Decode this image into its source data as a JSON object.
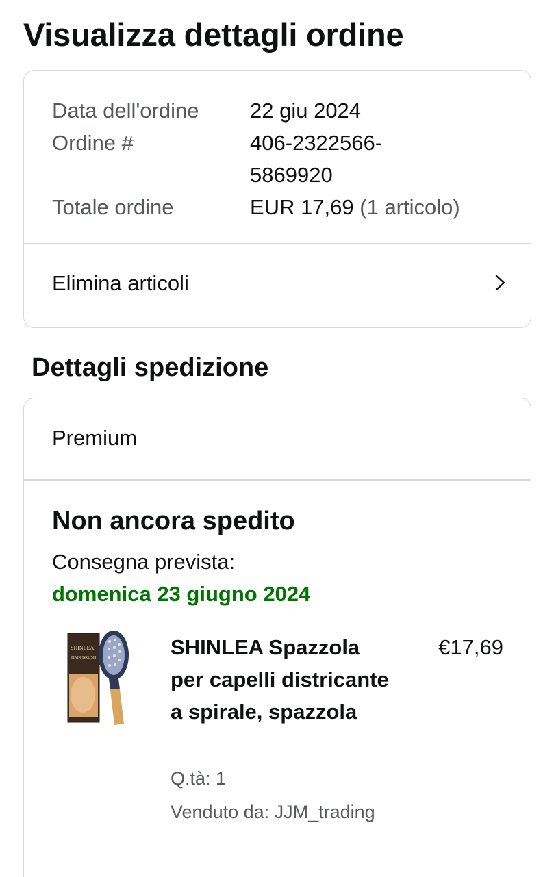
{
  "page": {
    "title": "Visualizza dettagli ordine"
  },
  "summary": {
    "date_label": "Data dell'ordine",
    "date_value": "22 giu 2024",
    "order_label": "Ordine #",
    "order_value_line1": "406-2322566-",
    "order_value_line2": "5869920",
    "total_label": "Totale ordine",
    "total_value": "EUR 17,69",
    "total_items": "(1 articolo)",
    "delete_items_label": "Elimina articoli",
    "delete_icon": "chevron-right-icon"
  },
  "shipping": {
    "section_title": "Dettagli spedizione",
    "service": "Premium",
    "status": "Non ancora spedito",
    "delivery_label": "Consegna prevista:",
    "delivery_date": "domenica 23 giugno 2024",
    "delivery_date_color": "#007600",
    "product": {
      "title": "SHINLEA Spazzola per capelli districante a spirale, spazzola",
      "price": "€17,69",
      "quantity": "Q.tà: 1",
      "seller": "Venduto da: JJM_trading",
      "image_brand": "SHINLEA",
      "image_text": "HAIR BRUSH"
    }
  },
  "colors": {
    "border": "#d5d9d9",
    "text": "#0f1111",
    "muted": "#565959"
  }
}
